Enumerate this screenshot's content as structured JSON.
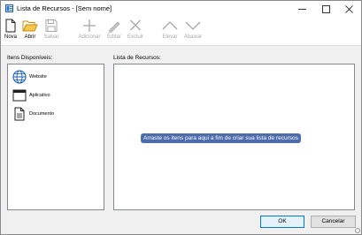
{
  "window": {
    "title": "Lista de Recursos - [Sem nome]",
    "controls": [
      "minimize",
      "maximize",
      "close"
    ]
  },
  "toolbar": {
    "items": [
      {
        "label": "Nova",
        "icon": "new-document-icon",
        "enabled": true
      },
      {
        "label": "Abrir",
        "icon": "open-folder-icon",
        "enabled": true
      },
      {
        "label": "Salvar",
        "icon": "save-disk-icon",
        "enabled": false
      },
      {
        "label": "Adicionar",
        "icon": "plus-icon",
        "enabled": false
      },
      {
        "label": "Editar",
        "icon": "pencil-icon",
        "enabled": false
      },
      {
        "label": "Excluir",
        "icon": "x-delete-icon",
        "enabled": false
      },
      {
        "label": "Elevar",
        "icon": "chevron-up-icon",
        "enabled": false
      },
      {
        "label": "Abaixar",
        "icon": "chevron-down-icon",
        "enabled": false
      }
    ]
  },
  "available": {
    "label": "Itens Disponíveis:",
    "items": [
      {
        "label": "Website",
        "icon": "globe-icon"
      },
      {
        "label": "Aplicativo",
        "icon": "application-window-icon"
      },
      {
        "label": "Documento",
        "icon": "document-icon"
      }
    ]
  },
  "resources": {
    "label": "Lista de Recursos:",
    "hint": "Arraste os itens para aqui a fim de criar sua lista de recursos"
  },
  "buttons": {
    "ok": "OK",
    "cancel": "Cancelar"
  },
  "colors": {
    "accent": "#0078d7",
    "hint_background": "#4d6cab",
    "disabled_text": "#a8a8a8",
    "open_folder": "#f0b429"
  }
}
